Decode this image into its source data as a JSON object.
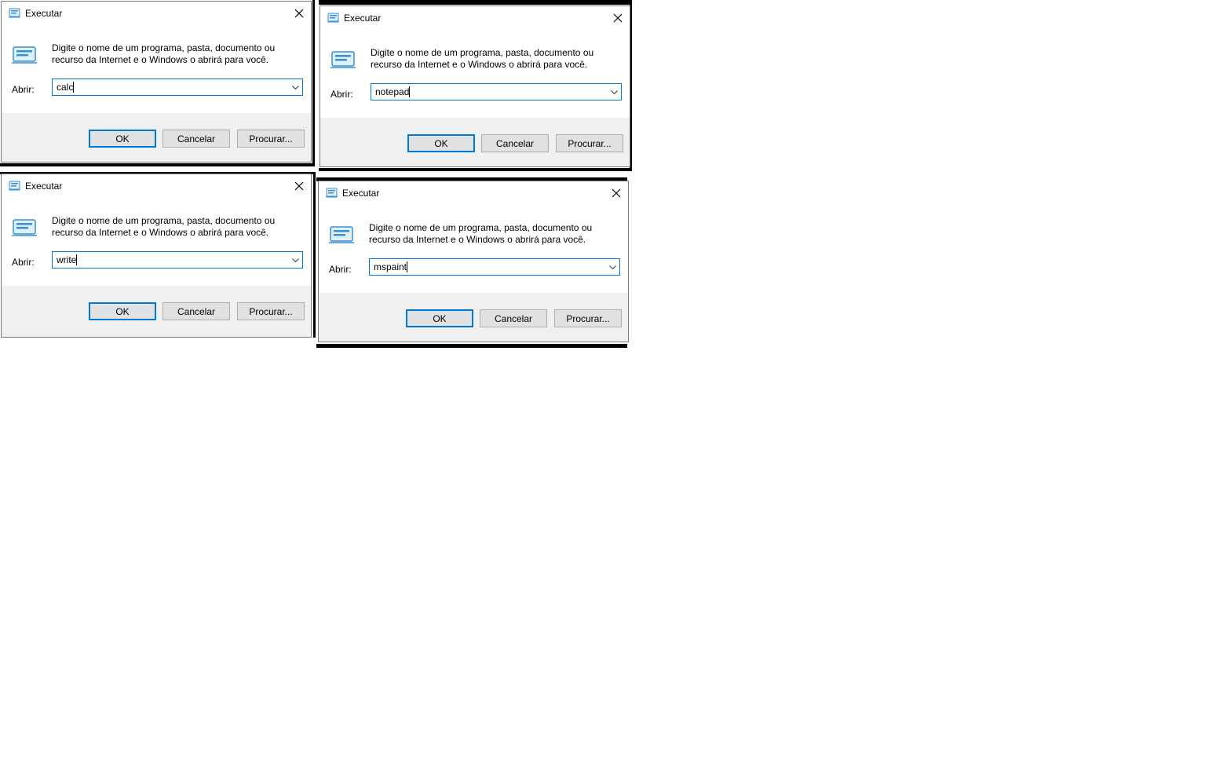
{
  "dialogs": [
    {
      "title": "Executar",
      "description": "Digite o nome de um programa, pasta, documento ou recurso da Internet e o Windows o abrirá para você.",
      "open_label": "Abrir:",
      "input_value": "calc",
      "buttons": {
        "ok": "OK",
        "cancel": "Cancelar",
        "browse": "Procurar..."
      }
    },
    {
      "title": "Executar",
      "description": "Digite o nome de um programa, pasta, documento ou recurso da Internet e o Windows o abrirá para você.",
      "open_label": "Abrir:",
      "input_value": "notepad",
      "buttons": {
        "ok": "OK",
        "cancel": "Cancelar",
        "browse": "Procurar..."
      }
    },
    {
      "title": "Executar",
      "description": "Digite o nome de um programa, pasta, documento ou recurso da Internet e o Windows o abrirá para você.",
      "open_label": "Abrir:",
      "input_value": "write",
      "buttons": {
        "ok": "OK",
        "cancel": "Cancelar",
        "browse": "Procurar..."
      }
    },
    {
      "title": "Executar",
      "description": "Digite o nome de um programa, pasta, documento ou recurso da Internet e o Windows o abrirá para você.",
      "open_label": "Abrir:",
      "input_value": "mspaint",
      "buttons": {
        "ok": "OK",
        "cancel": "Cancelar",
        "browse": "Procurar..."
      }
    }
  ],
  "colors": {
    "accent": "#0078d7",
    "dialog_bg": "#f0f0f0",
    "button_bg": "#e1e1e1"
  },
  "icons": {
    "title": "run-icon",
    "body": "run-large-icon",
    "close": "close-icon",
    "dropdown": "chevron-down-icon"
  }
}
